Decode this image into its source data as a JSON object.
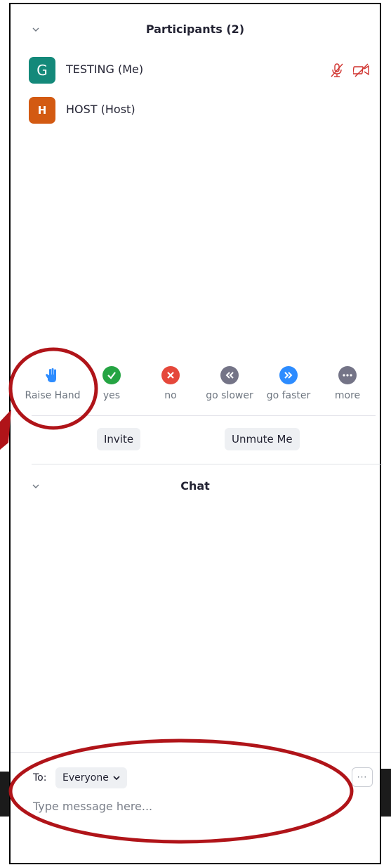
{
  "participants_panel": {
    "title": "Participants (2)",
    "participants": [
      {
        "initial": "G",
        "name": "TESTING (Me)",
        "avatar_color": "#14897a"
      },
      {
        "initial": "H",
        "name": "HOST (Host)",
        "avatar_color": "#d35a12"
      }
    ],
    "me_status_icons": [
      "muted-microphone-icon",
      "video-off-icon"
    ],
    "reactions": [
      {
        "label": "Raise Hand",
        "icon": "raise-hand-icon",
        "color": "#2d8cff"
      },
      {
        "label": "yes",
        "icon": "checkmark-icon",
        "color": "#25a443"
      },
      {
        "label": "no",
        "icon": "x-icon",
        "color": "#e5483b"
      },
      {
        "label": "go slower",
        "icon": "double-chevron-left-icon",
        "color": "#747487"
      },
      {
        "label": "go faster",
        "icon": "double-chevron-right-icon",
        "color": "#2d8cff"
      },
      {
        "label": "more",
        "icon": "ellipsis-icon",
        "color": "#747487"
      }
    ],
    "invite_label": "Invite",
    "unmute_label": "Unmute Me"
  },
  "chat_panel": {
    "title": "Chat",
    "to_label": "To:",
    "recipient": "Everyone",
    "message_placeholder": "Type message here...",
    "more_label": "···"
  },
  "colors": {
    "annotation_red": "#b01419",
    "muted_icon_red": "#d0312d"
  }
}
